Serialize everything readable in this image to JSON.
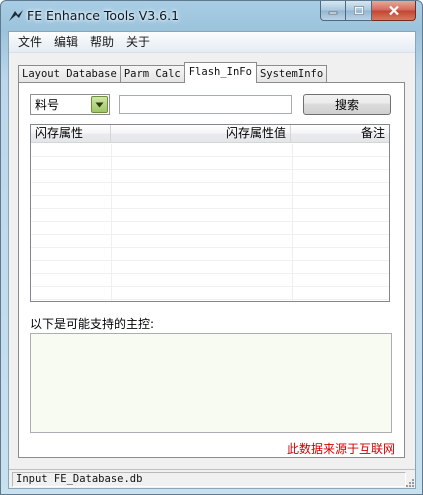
{
  "window": {
    "title": "FE Enhance Tools V3.6.1",
    "accent_color": "#9cc3dc",
    "close_color": "#c24330"
  },
  "menu": [
    "文件",
    "编辑",
    "帮助",
    "关于"
  ],
  "tabs": [
    {
      "label": "Layout Database",
      "active": false
    },
    {
      "label": "Parm Calc",
      "active": false
    },
    {
      "label": "Flash_InFo",
      "active": true
    },
    {
      "label": "SystemInfo",
      "active": false
    }
  ],
  "search": {
    "field_value": "料号",
    "input_value": "",
    "button_label": "搜索"
  },
  "table": {
    "columns": [
      "闪存属性",
      "闪存属性值",
      "备注"
    ],
    "rows": []
  },
  "support": {
    "label": "以下是可能支持的主控:",
    "value": ""
  },
  "source_note": {
    "text": "此数据来源于互联网",
    "color": "#d10000"
  },
  "status": {
    "text": "Input FE_Database.db"
  },
  "icons": [
    "app-logo-icon",
    "minimize-icon",
    "maximize-icon",
    "close-icon",
    "dropdown-arrow-icon",
    "size-grip-icon"
  ]
}
